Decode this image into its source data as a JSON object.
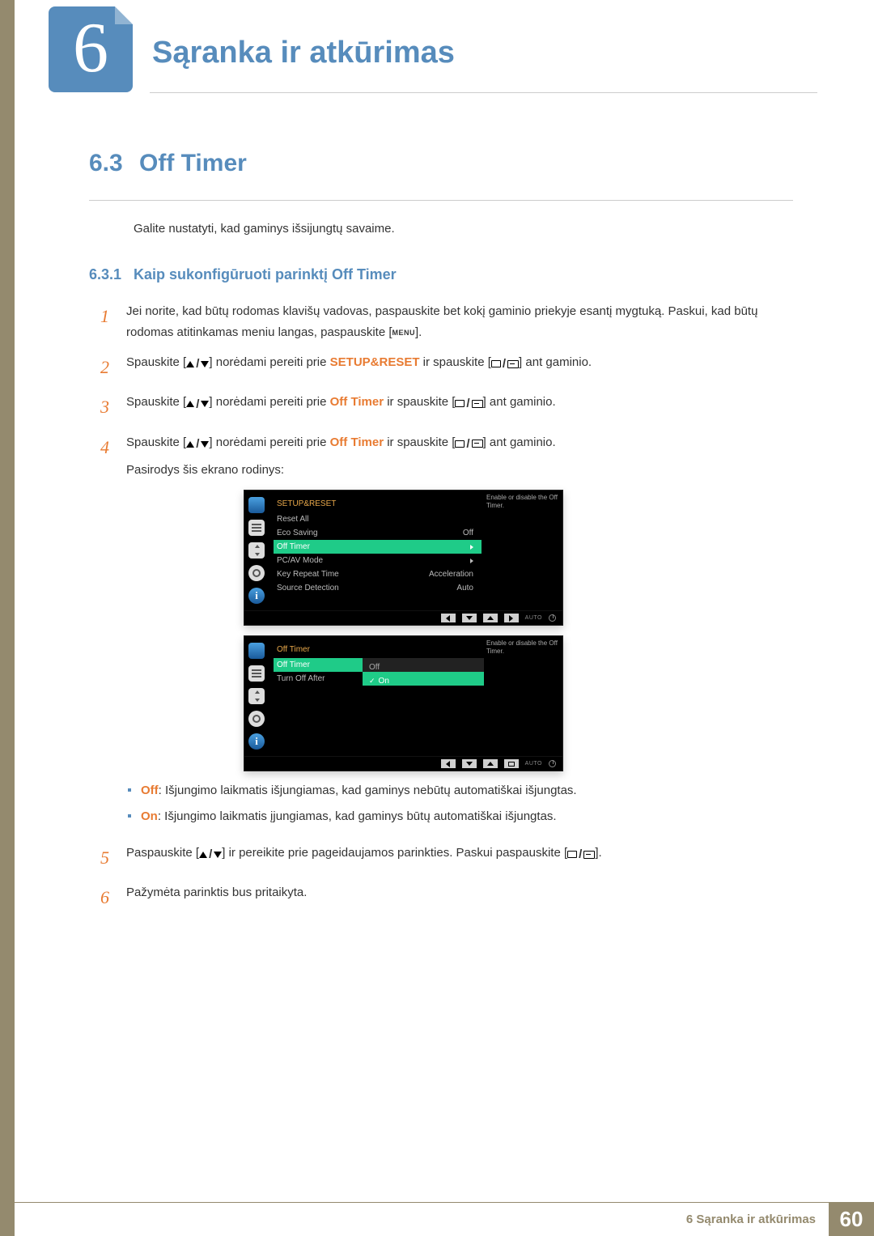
{
  "chapter": {
    "number": "6",
    "title": "Sąranka ir atkūrimas"
  },
  "section": {
    "number": "6.3",
    "title": "Off Timer"
  },
  "intro": "Galite nustatyti, kad gaminys išsijungtų savaime.",
  "subsection": {
    "number": "6.3.1",
    "title": "Kaip sukonfigūruoti parinktį Off Timer"
  },
  "steps": {
    "s1": {
      "n": "1",
      "a": "Jei norite, kad būtų rodomas klavišų vadovas, paspauskite bet kokį gaminio priekyje esantį mygtuką. Paskui, kad būtų rodomas atitinkamas meniu langas, paspauskite [",
      "menu": "MENU",
      "b": "]."
    },
    "s2": {
      "n": "2",
      "a": "Spauskite [",
      "b": "] norėdami pereiti prie ",
      "kw": "SETUP&RESET",
      "c": " ir spauskite [",
      "d": "] ant gaminio."
    },
    "s3": {
      "n": "3",
      "a": "Spauskite [",
      "b": "] norėdami pereiti prie ",
      "kw": "Off Timer",
      "c": " ir spauskite [",
      "d": "] ant gaminio."
    },
    "s4": {
      "n": "4",
      "a": "Spauskite [",
      "b": "] norėdami pereiti prie ",
      "kw": "Off Timer",
      "c": " ir spauskite [",
      "d": "] ant gaminio.",
      "after": "Pasirodys šis ekrano rodinys:"
    },
    "s5": {
      "n": "5",
      "a": "Paspauskite [",
      "b": "] ir pereikite prie pageidaujamos parinkties. Paskui paspauskite [",
      "c": "]."
    },
    "s6": {
      "n": "6",
      "a": "Pažymėta parinktis bus pritaikyta."
    }
  },
  "bullets": {
    "off": {
      "kw": "Off",
      "text": ": Išjungimo laikmatis išjungiamas, kad gaminys nebūtų automatiškai išjungtas."
    },
    "on": {
      "kw": "On",
      "text": ": Išjungimo laikmatis įjungiamas, kad gaminys būtų automatiškai išjungtas."
    }
  },
  "osd1": {
    "title": "SETUP&RESET",
    "tip": "Enable or disable the Off Timer.",
    "rows": {
      "r1": {
        "label": "Reset All",
        "value": ""
      },
      "r2": {
        "label": "Eco Saving",
        "value": "Off"
      },
      "r3": {
        "label": "Off Timer",
        "value": ""
      },
      "r4": {
        "label": "PC/AV Mode",
        "value": ""
      },
      "r5": {
        "label": "Key Repeat Time",
        "value": "Acceleration"
      },
      "r6": {
        "label": "Source Detection",
        "value": "Auto"
      }
    },
    "auto": "AUTO"
  },
  "osd2": {
    "title": "Off Timer",
    "tip": "Enable or disable the Off Timer.",
    "rows": {
      "r1": {
        "label": "Off Timer",
        "value": "Off"
      },
      "r2": {
        "label": "Turn Off After",
        "value": ""
      }
    },
    "dropdown": {
      "opt1": "Off",
      "opt2": "On"
    },
    "auto": "AUTO"
  },
  "footer": {
    "chapter": "6 Sąranka ir atkūrimas",
    "page": "60"
  }
}
